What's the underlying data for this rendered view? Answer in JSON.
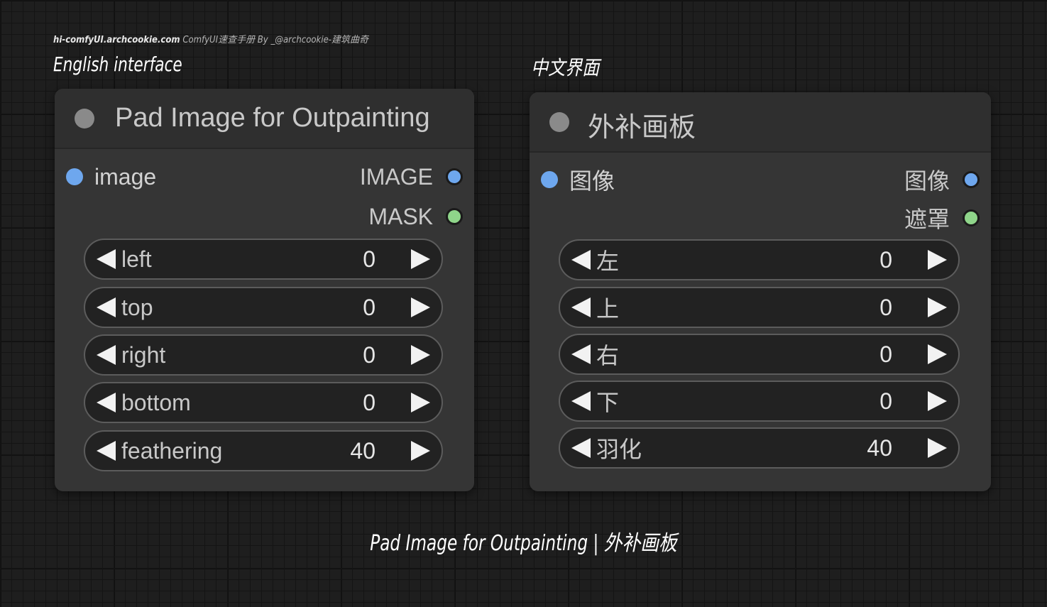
{
  "credit": {
    "site": "hi-comfyUI.archcookie.com",
    "rest": "ComfyUI速查手册 By _@archcookie-建筑曲奇"
  },
  "labels": {
    "english": "English interface",
    "chinese": "中文界面"
  },
  "caption": "Pad Image for Outpainting | 外补画板",
  "colors": {
    "image_slot": "#6ea7ee",
    "mask_slot": "#8fd58a",
    "node_bg": "#353535",
    "canvas_bg": "#1e1e1e"
  },
  "node_en": {
    "title": "Pad Image for Outpainting",
    "input_image": "image",
    "output_image": "IMAGE",
    "output_mask": "MASK",
    "widgets": [
      {
        "label": "left",
        "value": "0"
      },
      {
        "label": "top",
        "value": "0"
      },
      {
        "label": "right",
        "value": "0"
      },
      {
        "label": "bottom",
        "value": "0"
      },
      {
        "label": "feathering",
        "value": "40"
      }
    ]
  },
  "node_zh": {
    "title": "外补画板",
    "input_image": "图像",
    "output_image": "图像",
    "output_mask": "遮罩",
    "widgets": [
      {
        "label": "左",
        "value": "0"
      },
      {
        "label": "上",
        "value": "0"
      },
      {
        "label": "右",
        "value": "0"
      },
      {
        "label": "下",
        "value": "0"
      },
      {
        "label": "羽化",
        "value": "40"
      }
    ]
  }
}
